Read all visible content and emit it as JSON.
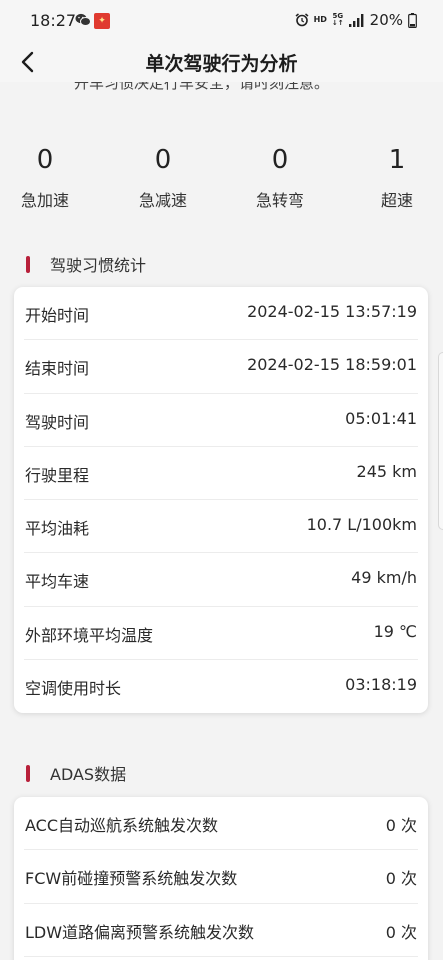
{
  "status_bar": {
    "time": "18:27",
    "hd": "HD",
    "network": "5G",
    "battery_percent": "20%",
    "icons": [
      "wechat-icon",
      "app-notification-icon",
      "alarm-icon",
      "signal-icon",
      "battery-icon"
    ]
  },
  "header": {
    "title": "单次驾驶行为分析"
  },
  "partial_text": "开车习惯决定行车安全，请时刻注意。",
  "stats": [
    {
      "value": "0",
      "label": "急加速"
    },
    {
      "value": "0",
      "label": "急减速"
    },
    {
      "value": "0",
      "label": "急转弯"
    },
    {
      "value": "1",
      "label": "超速"
    }
  ],
  "habit_section": {
    "title": "驾驶习惯统计",
    "rows": [
      {
        "label": "开始时间",
        "value": "2024-02-15 13:57:19"
      },
      {
        "label": "结束时间",
        "value": "2024-02-15 18:59:01"
      },
      {
        "label": "驾驶时间",
        "value": "05:01:41"
      },
      {
        "label": "行驶里程",
        "value": "245 km"
      },
      {
        "label": "平均油耗",
        "value": "10.7 L/100km"
      },
      {
        "label": "平均车速",
        "value": "49 km/h"
      },
      {
        "label": "外部环境平均温度",
        "value": "19 ℃"
      },
      {
        "label": "空调使用时长",
        "value": "03:18:19"
      }
    ]
  },
  "adas_section": {
    "title": "ADAS数据",
    "rows": [
      {
        "label": "ACC自动巡航系统触发次数",
        "value": "0 次"
      },
      {
        "label": "FCW前碰撞预警系统触发次数",
        "value": "0 次"
      },
      {
        "label": "LDW道路偏离预警系统触发次数",
        "value": "0 次"
      }
    ]
  },
  "colors": {
    "accent": "#b8203a",
    "background": "#f3f3f3",
    "card": "#ffffff"
  }
}
